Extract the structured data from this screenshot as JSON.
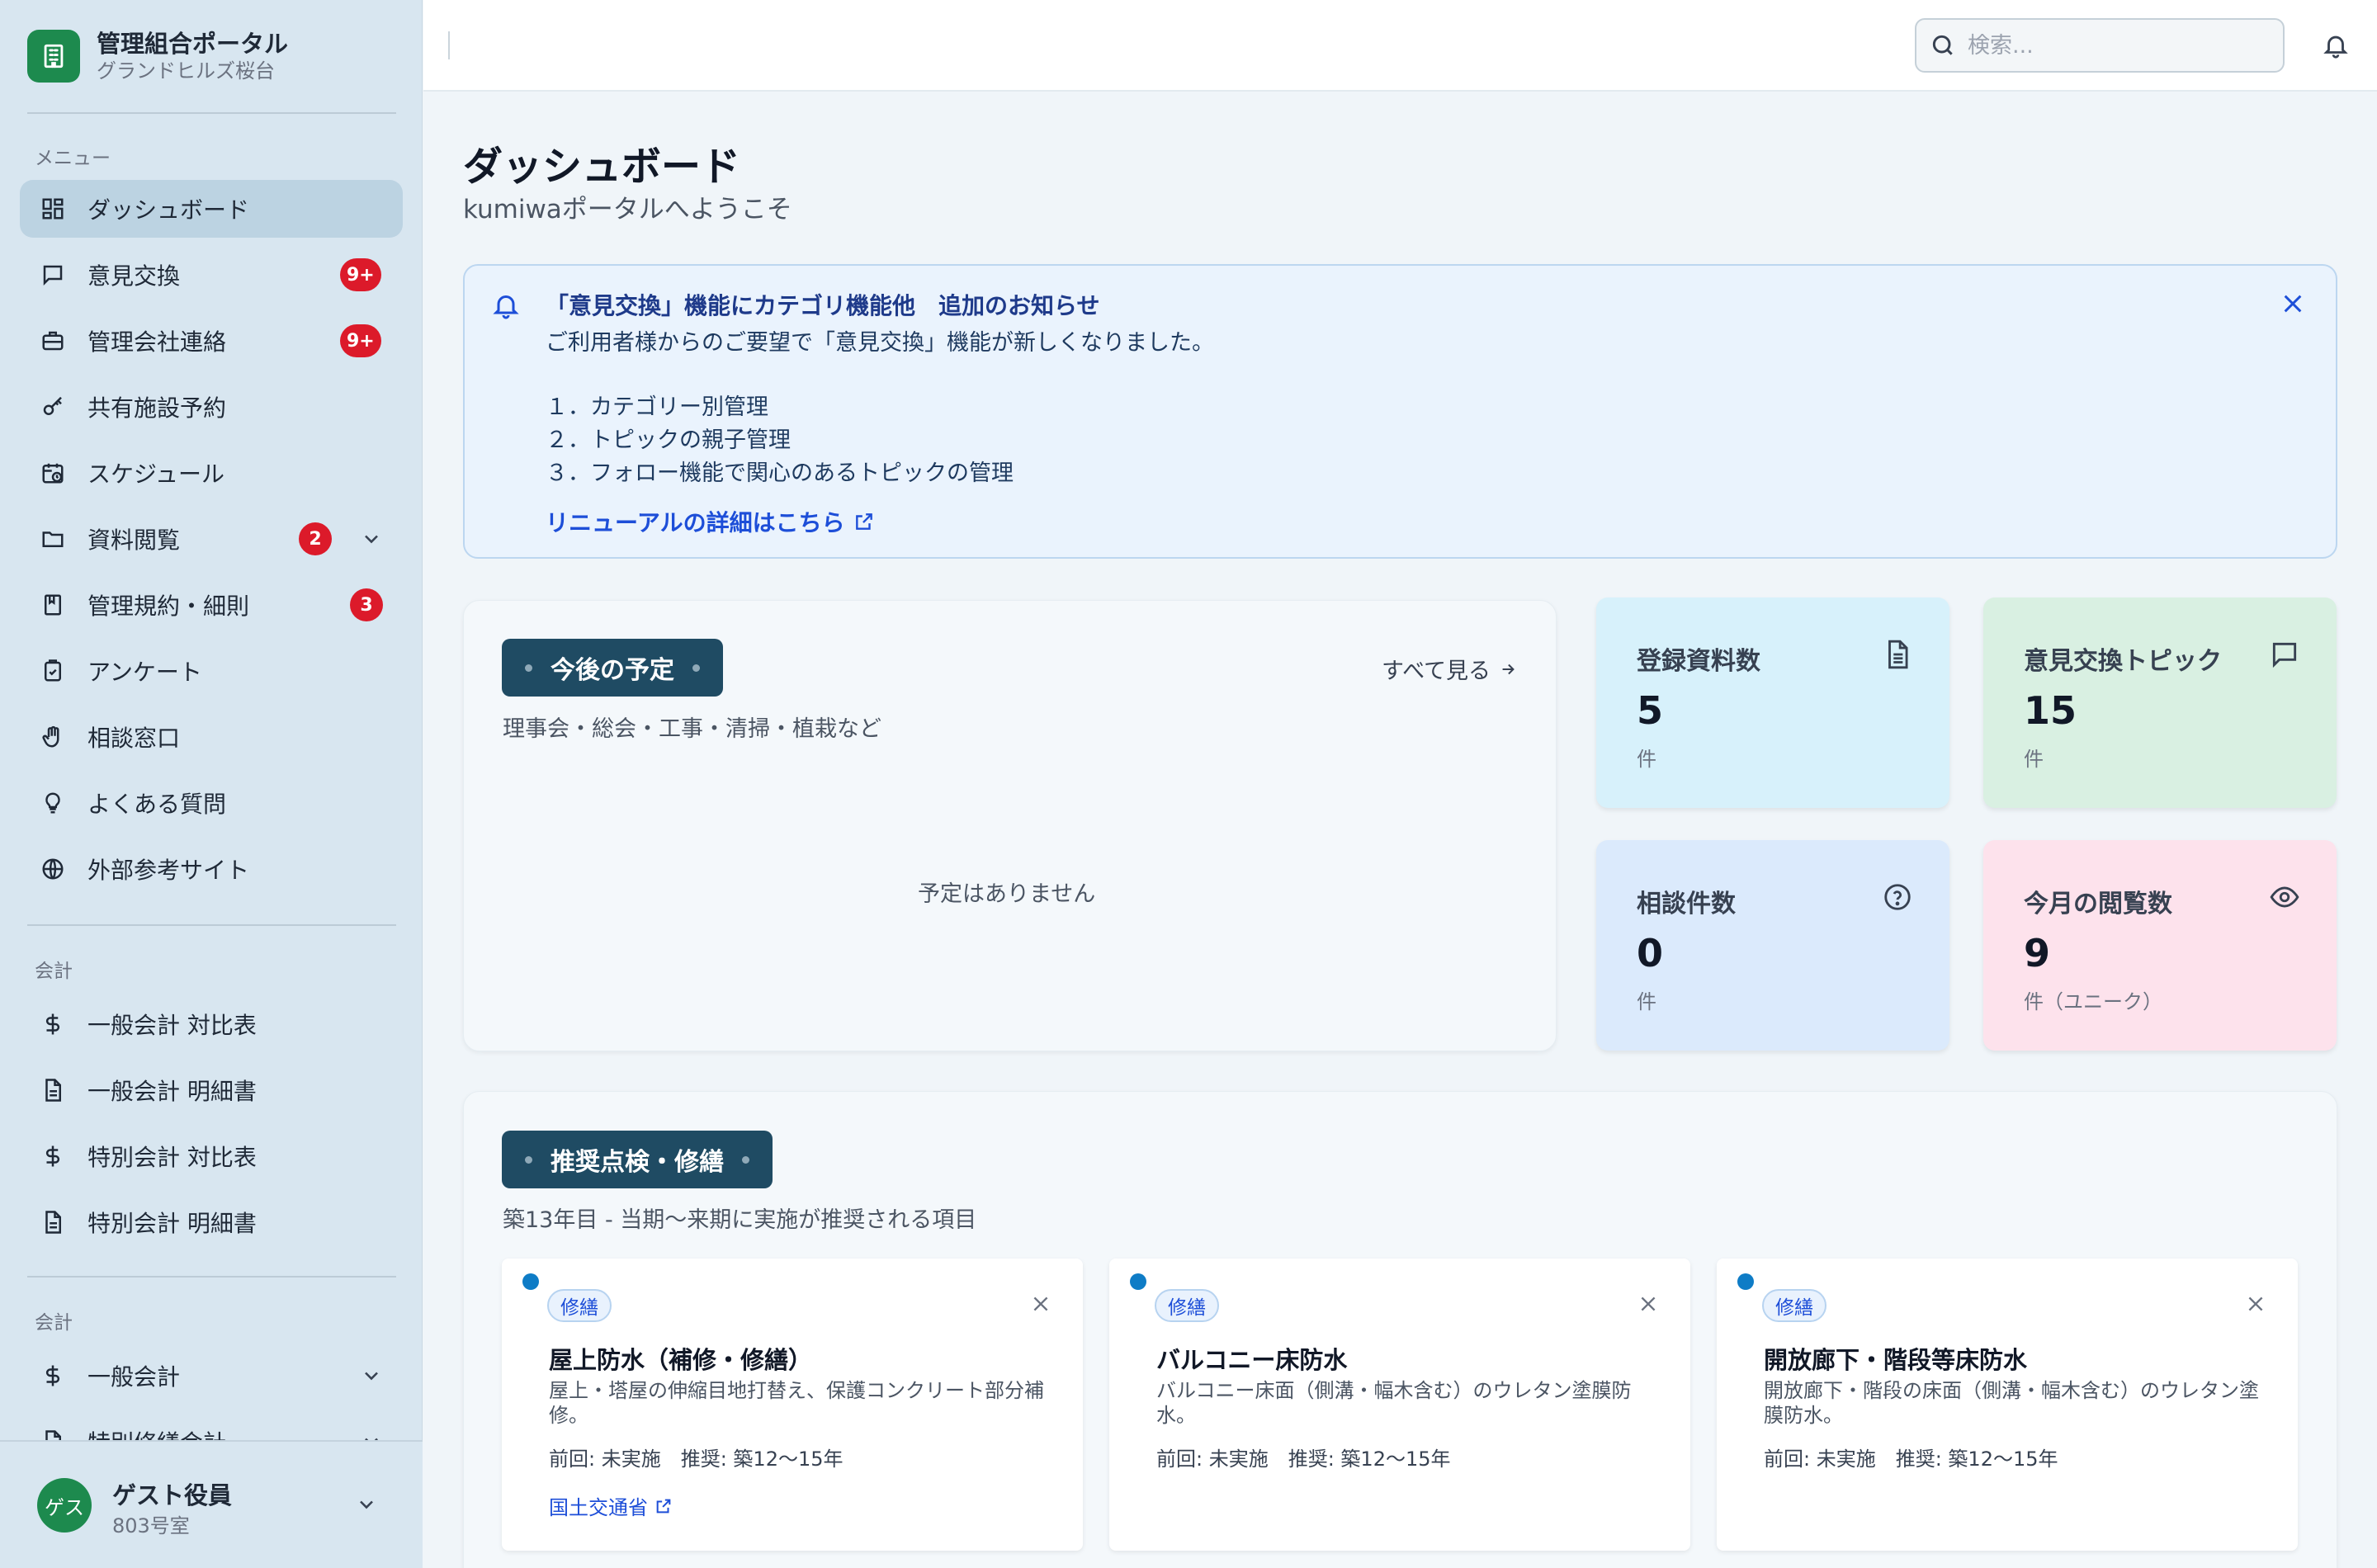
{
  "brand": {
    "title": "管理組合ポータル",
    "subtitle": "グランドヒルズ桜台"
  },
  "sidebar": {
    "menu_label": "メニュー",
    "items": [
      {
        "label": "ダッシュボード",
        "icon": "dashboard-icon"
      },
      {
        "label": "意見交換",
        "icon": "chat-icon",
        "badge": "9+"
      },
      {
        "label": "管理会社連絡",
        "icon": "briefcase-icon",
        "badge": "9+"
      },
      {
        "label": "共有施設予約",
        "icon": "key-icon"
      },
      {
        "label": "スケジュール",
        "icon": "calendar-clock-icon"
      },
      {
        "label": "資料閲覧",
        "icon": "folder-icon",
        "badge": "2"
      },
      {
        "label": "管理規約・細則",
        "icon": "book-icon",
        "badge": "3"
      },
      {
        "label": "アンケート",
        "icon": "clipboard-check-icon"
      },
      {
        "label": "相談窓口",
        "icon": "hand-icon"
      },
      {
        "label": "よくある質問",
        "icon": "lightbulb-icon"
      },
      {
        "label": "外部参考サイト",
        "icon": "globe-icon"
      }
    ],
    "accounting_label": "会計",
    "accounting_items": [
      {
        "label": "一般会計 対比表",
        "icon": "dollar-icon"
      },
      {
        "label": "一般会計 明細書",
        "icon": "document-icon"
      },
      {
        "label": "特別会計 対比表",
        "icon": "dollar-icon"
      },
      {
        "label": "特別会計 明細書",
        "icon": "document-icon"
      }
    ],
    "accounting2_label": "会計",
    "accounting2_items": [
      {
        "label": "一般会計",
        "icon": "dollar-icon"
      },
      {
        "label": "特別修繕会計",
        "icon": "document-icon"
      }
    ]
  },
  "user": {
    "avatar": "ゲス",
    "name": "ゲスト役員",
    "room": "803号室"
  },
  "topbar": {
    "search_placeholder": "検索..."
  },
  "page": {
    "title": "ダッシュボード",
    "subtitle": "kumiwaポータルへようこそ"
  },
  "notice": {
    "title": "「意見交換」機能にカテゴリ機能他　追加のお知らせ",
    "body": "ご利用者様からのご要望で「意見交換」機能が新しくなりました。",
    "list": [
      "１．カテゴリー別管理",
      "２．トピックの親子管理",
      "３．フォロー機能で関心のあるトピックの管理"
    ],
    "link": "リニューアルの詳細はこちら"
  },
  "schedule": {
    "title": "今後の予定",
    "see_all": "すべて見る",
    "desc": "理事会・総会・工事・清掃・植栽など",
    "empty": "予定はありません"
  },
  "stats": [
    {
      "label": "登録資料数",
      "value": "5",
      "unit": "件",
      "icon": "document-icon",
      "color": "#d7f1fb"
    },
    {
      "label": "意見交換トピック",
      "value": "15",
      "unit": "件",
      "icon": "chat-icon",
      "color": "#d9f0e2"
    },
    {
      "label": "相談件数",
      "value": "0",
      "unit": "件",
      "icon": "question-circle-icon",
      "color": "#dbeafc"
    },
    {
      "label": "今月の閲覧数",
      "value": "9",
      "unit": "件（ユニーク）",
      "icon": "eye-icon",
      "color": "#fde2ec"
    }
  ],
  "maintenance": {
    "title": "推奨点検・修繕",
    "desc": "築13年目 - 当期〜来期に実施が推奨される項目",
    "items": [
      {
        "tag": "修繕",
        "title": "屋上防水（補修・修繕）",
        "desc": "屋上・塔屋の伸縮目地打替え、保護コンクリート部分補修。",
        "meta": "前回: 未実施　推奨: 築12〜15年",
        "link": "国土交通省"
      },
      {
        "tag": "修繕",
        "title": "バルコニー床防水",
        "desc": "バルコニー床面（側溝・幅木含む）のウレタン塗膜防水。",
        "meta": "前回: 未実施　推奨: 築12〜15年"
      },
      {
        "tag": "修繕",
        "title": "開放廊下・階段等床防水",
        "desc": "開放廊下・階段の床面（側溝・幅木含む）のウレタン塗膜防水。",
        "meta": "前回: 未実施　推奨: 築12〜15年"
      }
    ]
  }
}
